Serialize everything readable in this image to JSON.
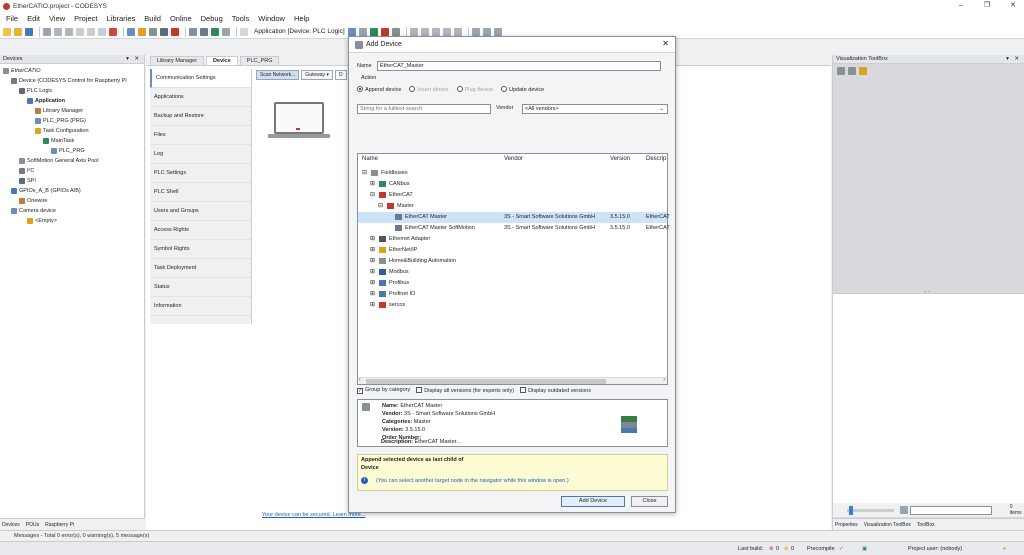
{
  "window": {
    "title": "EtherCATIO.project - CODESYS",
    "min": "–",
    "max": "❐",
    "close": "✕"
  },
  "menu": [
    "File",
    "Edit",
    "View",
    "Project",
    "Libraries",
    "Build",
    "Online",
    "Debug",
    "Tools",
    "Window",
    "Help"
  ],
  "toolbar": {
    "application": "Application [Device: PLC Logic]"
  },
  "devices_panel": {
    "title": "Devices",
    "controls": "▾ ✕",
    "tree": [
      {
        "label": "EtherCATIO",
        "indent": 0,
        "italic": true
      },
      {
        "label": "Device (CODESYS Control for Raspberry Pi",
        "indent": 1
      },
      {
        "label": "PLC Logic",
        "indent": 2
      },
      {
        "label": "Application",
        "indent": 3,
        "bold": true
      },
      {
        "label": "Library Manager",
        "indent": 4
      },
      {
        "label": "PLC_PRG (PRG)",
        "indent": 4
      },
      {
        "label": "Task Configuration",
        "indent": 4
      },
      {
        "label": "MainTask",
        "indent": 5
      },
      {
        "label": "PLC_PRG",
        "indent": 6
      },
      {
        "label": "SoftMotion General Axis Pool",
        "indent": 2
      },
      {
        "label": "I²C",
        "indent": 2
      },
      {
        "label": "SPI",
        "indent": 2
      },
      {
        "label": "GPIOs_A_B (GPIOs A/B)",
        "indent": 1
      },
      {
        "label": "Onewire",
        "indent": 2
      },
      {
        "label": "Camera device",
        "indent": 1
      },
      {
        "label": "<Empty>",
        "indent": 3
      }
    ],
    "bottom_tabs": [
      "Devices",
      "POUs",
      "Raspberry Pi"
    ]
  },
  "editor": {
    "tabs": [
      {
        "label": "Library Manager",
        "active": false
      },
      {
        "label": "Device",
        "active": true
      },
      {
        "label": "PLC_PRG",
        "active": false
      }
    ],
    "nav": [
      "Communication Settings",
      "Applications",
      "Backup and Restore",
      "Files",
      "Log",
      "PLC Settings",
      "PLC Shell",
      "Users and Groups",
      "Access Rights",
      "Symbol Rights",
      "Task Deployment",
      "Status",
      "Information"
    ],
    "scan_network": "Scan Network...",
    "gateway": "Gateway ▾",
    "gateway_cut": "D",
    "secure_link": "Your device can be secured. Learn more..."
  },
  "viz_panel": {
    "title": "Visualization ToolBox",
    "controls": "▾ ✕",
    "items_count": "0 items",
    "bottom_tabs": [
      "Properties",
      "Visualization ToolBox",
      "ToolBox"
    ]
  },
  "messages_bar": "Messages - Total 0 error(s), 0 warning(s), 5 message(s)",
  "status": {
    "last_build": "Last build:",
    "errors": "0",
    "warnings": "0",
    "precompile": "Precompile",
    "project_user": "Project user: (nobody)"
  },
  "dialog": {
    "title": "Add Device",
    "close": "✕",
    "name_label": "Name",
    "name_value": "EtherCAT_Master",
    "action_label": "Action",
    "actions": [
      {
        "label": "Append device",
        "selected": true,
        "enabled": true
      },
      {
        "label": "Insert device",
        "selected": false,
        "enabled": false
      },
      {
        "label": "Plug device",
        "selected": false,
        "enabled": false
      },
      {
        "label": "Update device",
        "selected": false,
        "enabled": true
      }
    ],
    "search_placeholder": "String for a fulltext search",
    "vendor_label": "Vendor",
    "vendor_value": "<All vendors>",
    "columns": [
      "Name",
      "Vendor",
      "Version",
      "Descrip"
    ],
    "rows": [
      {
        "name": "Fieldbuses",
        "indent": 0,
        "tw": "⊟",
        "vendor": "",
        "version": "",
        "desc": "",
        "icolor": "#8a8f96"
      },
      {
        "name": "CANbus",
        "indent": 1,
        "tw": "⊞",
        "vendor": "",
        "version": "",
        "desc": "",
        "icolor": "#2e8b57",
        "prefix": "CiA"
      },
      {
        "name": "EtherCAT",
        "indent": 1,
        "tw": "⊟",
        "vendor": "",
        "version": "",
        "desc": "",
        "icolor": "#c0392b"
      },
      {
        "name": "Master",
        "indent": 2,
        "tw": "⊟",
        "vendor": "",
        "version": "",
        "desc": "",
        "icolor": "#c0392b"
      },
      {
        "name": "EtherCAT Master",
        "indent": 3,
        "tw": "",
        "vendor": "3S - Smart Software Solutions GmbH",
        "version": "3.5.15.0",
        "desc": "EtherCAT",
        "icolor": "#6b7b8c",
        "selected": true
      },
      {
        "name": "EtherCAT Master SoftMotion",
        "indent": 3,
        "tw": "",
        "vendor": "3S - Smart Software Solutions GmbH",
        "version": "3.5.15.0",
        "desc": "EtherCAT",
        "icolor": "#6b7b8c"
      },
      {
        "name": "Ethernet Adapter",
        "indent": 1,
        "tw": "⊞",
        "vendor": "",
        "version": "",
        "desc": "",
        "icolor": "#555"
      },
      {
        "name": "EtherNet/IP",
        "indent": 1,
        "tw": "⊞",
        "vendor": "",
        "version": "",
        "desc": "",
        "icolor": "#e0a020"
      },
      {
        "name": "Home&Building Automation",
        "indent": 1,
        "tw": "⊞",
        "vendor": "",
        "version": "",
        "desc": "",
        "icolor": "#8a8f96"
      },
      {
        "name": "Modbus",
        "indent": 1,
        "tw": "⊞",
        "vendor": "",
        "version": "",
        "desc": "",
        "icolor": "#2c5fa8"
      },
      {
        "name": "Profibus",
        "indent": 1,
        "tw": "⊞",
        "vendor": "",
        "version": "",
        "desc": "",
        "icolor": "#4a78b0"
      },
      {
        "name": "Profinet IO",
        "indent": 1,
        "tw": "⊞",
        "vendor": "",
        "version": "",
        "desc": "",
        "icolor": "#4a78b0"
      },
      {
        "name": "sercos",
        "indent": 1,
        "tw": "⊞",
        "vendor": "",
        "version": "",
        "desc": "",
        "icolor": "#c0392b",
        "prefix": "S"
      }
    ],
    "group_by_category": "Group by category",
    "display_all_versions": "Display all versions (for experts only)",
    "display_outdated": "Display outdated versions",
    "info": {
      "name_label": "Name:",
      "name": "EtherCAT Master",
      "vendor_label": "Vendor:",
      "vendor": "3S - Smart Software Solutions GmbH",
      "categories_label": "Categories:",
      "categories": "Master",
      "version_label": "Version:",
      "version": "3.5.15.0",
      "order_label": "Order Number:",
      "order": "",
      "desc_label": "Description:",
      "desc": "EtherCAT Master..."
    },
    "append_hint": "Append selected device as last child of",
    "append_target": "Device",
    "hint_note": "(You can select another target node in the navigator while this window is open.)",
    "add_button": "Add Device",
    "close_button": "Close"
  },
  "colors": {
    "accent": "#4a78b0",
    "selection": "#cde3f7",
    "link": "#1f5fbf",
    "hint_bg": "#fdfbd4"
  }
}
